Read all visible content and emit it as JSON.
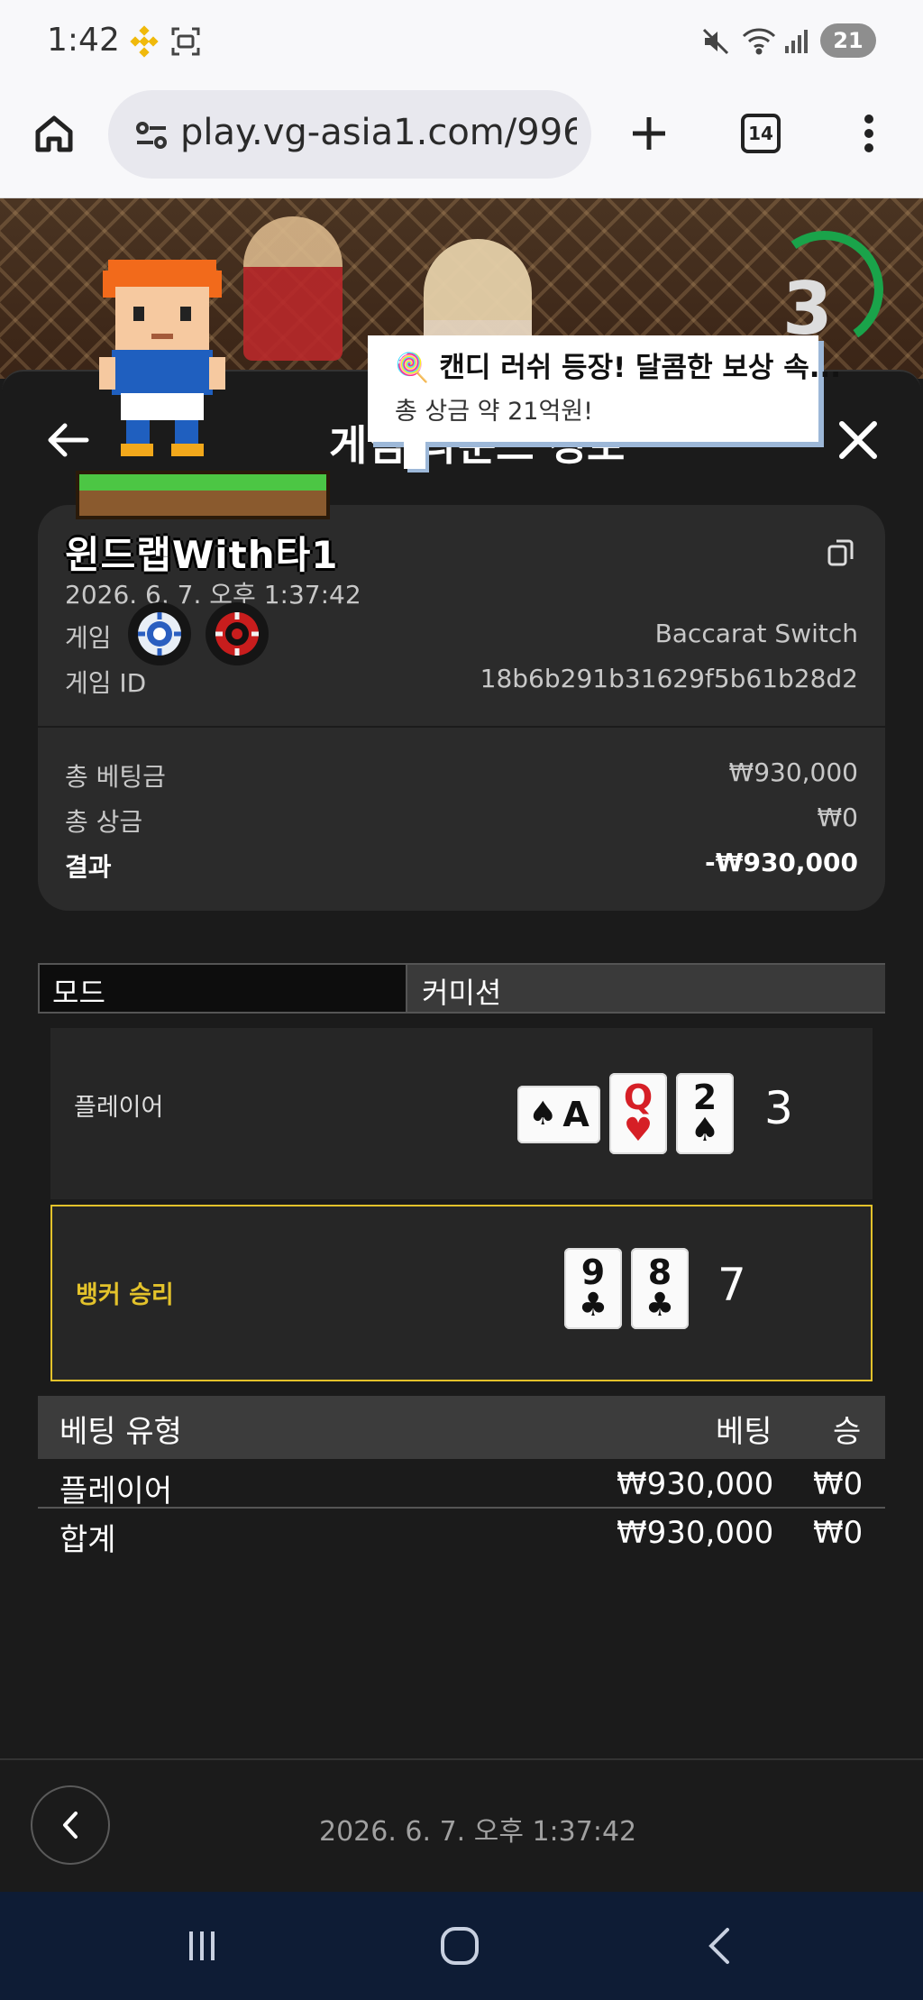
{
  "status_bar": {
    "time": "1:42",
    "battery": "21"
  },
  "browser": {
    "url": "play.vg-asia1.com/996",
    "tab_count": "14"
  },
  "video": {
    "countdown": "3"
  },
  "toast": {
    "title": "🍭 캔디 러쉬 등장! 달콤한 보상 속...",
    "subtitle": "총 상금 약 21억원!"
  },
  "logo": {
    "text": "윈드랩With타1"
  },
  "header": {
    "title": "게임 라운드 정보"
  },
  "summary": {
    "date": "2026. 6. 7. 오후 1:37:42",
    "game_label": "게임",
    "game_value": "Baccarat Switch",
    "game_id_label": "게임 ID",
    "game_id_value": "18b6b291b31629f5b61b28d2",
    "total_bet_label": "총 베팅금",
    "total_bet_value": "₩930,000",
    "total_win_label": "총 상금",
    "total_win_value": "₩0",
    "result_label": "결과",
    "result_value": "-₩930,000"
  },
  "mode": {
    "label": "모드",
    "value": "커미션"
  },
  "hands": {
    "player": {
      "label": "플레이어",
      "total": "3",
      "cards": [
        {
          "rank": "A",
          "suit": "♠",
          "color": "#111111"
        },
        {
          "rank": "Q",
          "suit": "♥",
          "color": "#d61f26"
        },
        {
          "rank": "2",
          "suit": "♠",
          "color": "#111111"
        }
      ]
    },
    "banker": {
      "label": "뱅커 승리",
      "total": "7",
      "cards": [
        {
          "rank": "9",
          "suit": "♣",
          "color": "#111111"
        },
        {
          "rank": "8",
          "suit": "♣",
          "color": "#111111"
        }
      ],
      "highlight_color": "#e3c22b"
    }
  },
  "bets": {
    "headers": {
      "type": "베팅 유형",
      "bet": "베팅",
      "win": "승"
    },
    "rows": [
      {
        "type": "플레이어",
        "bet": "₩930,000",
        "win": "₩0"
      }
    ],
    "total": {
      "type": "합계",
      "bet": "₩930,000",
      "win": "₩0"
    }
  },
  "footer": {
    "date": "2026. 6. 7. 오후 1:37:42"
  }
}
